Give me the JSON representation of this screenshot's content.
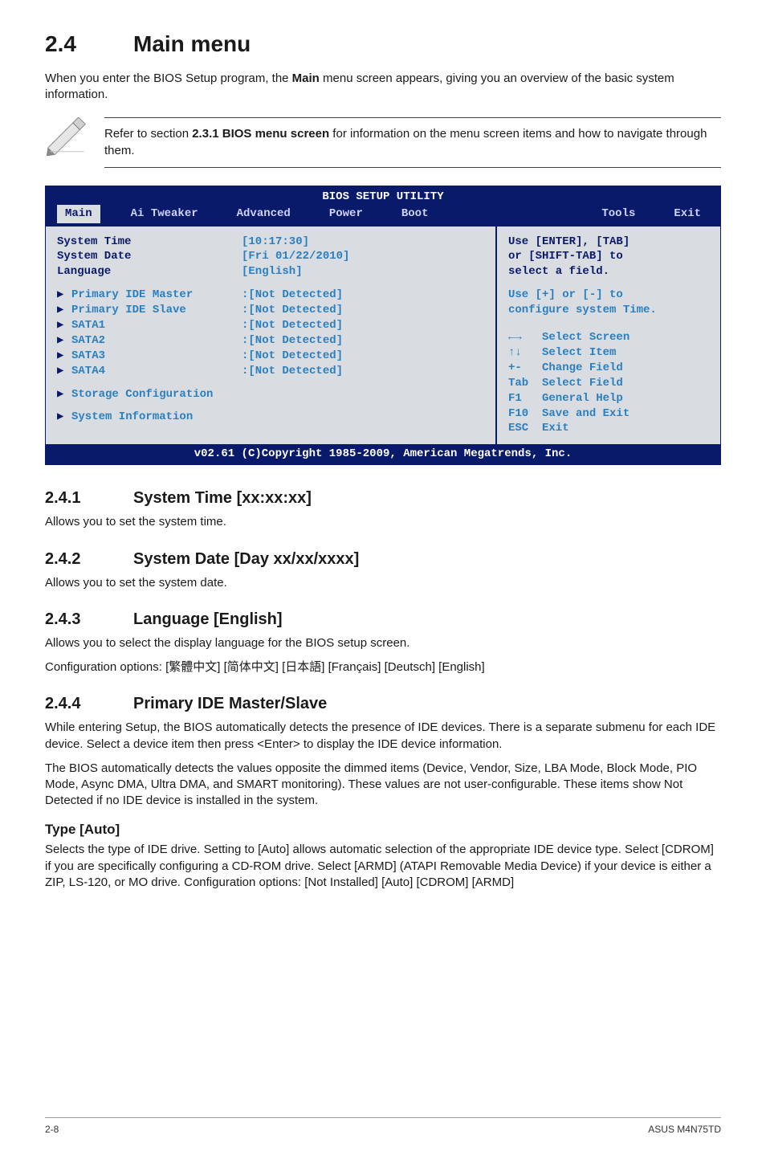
{
  "h1": {
    "num": "2.4",
    "title": "Main menu"
  },
  "intro": {
    "pre": "When you enter the BIOS Setup program, the ",
    "bold": "Main",
    "post": " menu screen appears, giving you an overview of the basic system information."
  },
  "note": {
    "pre": "Refer to section ",
    "bold": "2.3.1 BIOS menu screen",
    "post": " for information on the menu screen items and how to navigate through them."
  },
  "bios": {
    "title": "BIOS SETUP UTILITY",
    "tabs": {
      "main": "Main",
      "ai": "Ai Tweaker",
      "adv": "Advanced",
      "power": "Power",
      "boot": "Boot",
      "tools": "Tools",
      "exit": "Exit"
    },
    "left": {
      "r1": {
        "label": "System Time",
        "value": "[10:17:30]"
      },
      "r2": {
        "label": "System Date",
        "value": "[Fri 01/22/2010]"
      },
      "r3": {
        "label": "Language",
        "value": "[English]"
      },
      "items": {
        "i1": {
          "label": "Primary IDE Master",
          "value": ":[Not Detected]"
        },
        "i2": {
          "label": "Primary IDE Slave",
          "value": ":[Not Detected]"
        },
        "i3": {
          "label": "SATA1",
          "value": ":[Not Detected]"
        },
        "i4": {
          "label": "SATA2",
          "value": ":[Not Detected]"
        },
        "i5": {
          "label": "SATA3",
          "value": ":[Not Detected]"
        },
        "i6": {
          "label": "SATA4",
          "value": ":[Not Detected]"
        }
      },
      "storage": "Storage Configuration",
      "sysinfo": "System Information"
    },
    "right": {
      "hint1": "Use [ENTER], [TAB]\nor [SHIFT-TAB] to\nselect a field.",
      "hint2": "Use [+] or [-] to\nconfigure system Time.",
      "keys": "←→   Select Screen\n↑↓   Select Item\n+-   Change Field\nTab  Select Field\nF1   General Help\nF10  Save and Exit\nESC  Exit"
    },
    "footer": "v02.61 (C)Copyright 1985-2009, American Megatrends, Inc."
  },
  "s241": {
    "num": "2.4.1",
    "title": "System Time [xx:xx:xx]",
    "body": "Allows you to set the system time."
  },
  "s242": {
    "num": "2.4.2",
    "title": "System Date [Day xx/xx/xxxx]",
    "body": "Allows you to set the system date."
  },
  "s243": {
    "num": "2.4.3",
    "title": "Language [English]",
    "b1": "Allows you to select the display language for the BIOS setup screen.",
    "b2": "Configuration options: [繁體中文] [简体中文] [日本語] [Français] [Deutsch] [English]"
  },
  "s244": {
    "num": "2.4.4",
    "title": "Primary IDE Master/Slave",
    "p1": "While entering Setup, the BIOS automatically detects the presence of IDE devices. There is a separate submenu for each IDE device. Select a device item then press <Enter> to display the IDE device information.",
    "p2": "The BIOS automatically detects the values opposite the dimmed items (Device, Vendor, Size, LBA Mode, Block Mode, PIO Mode, Async DMA, Ultra DMA, and SMART monitoring). These values are not user-configurable. These items show Not Detected if no IDE device is installed in the system."
  },
  "type": {
    "title": "Type [Auto]",
    "body": "Selects the type of IDE drive. Setting to [Auto] allows automatic selection of the appropriate IDE device type. Select [CDROM] if you are specifically configuring a CD-ROM drive. Select [ARMD] (ATAPI Removable Media Device) if your device is either a ZIP, LS-120, or MO drive. Configuration options: [Not Installed] [Auto] [CDROM] [ARMD]"
  },
  "footer": {
    "left": "2-8",
    "right": "ASUS M4N75TD"
  }
}
